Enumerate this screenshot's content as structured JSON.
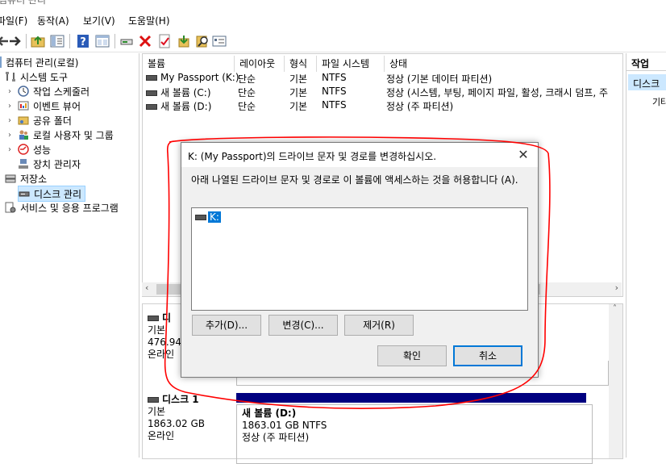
{
  "window": {
    "title": "컴퓨터 관리"
  },
  "menu": [
    "파일(F)",
    "동작(A)",
    "보기(V)",
    "도움말(H)"
  ],
  "toolbar_icons": [
    "back-arrow-icon",
    "forward-arrow-icon",
    "up-folder-icon",
    "console-tree-icon",
    "help-icon",
    "view-icon",
    "connect-drive-icon",
    "delete-icon",
    "properties-icon",
    "import-icon",
    "search-icon",
    "settings-icon"
  ],
  "tree": {
    "root": "컴퓨터 관리(로컬)",
    "items": [
      "시스템 도구",
      "작업 스케줄러",
      "이벤트 뷰어",
      "공유 폴더",
      "로컬 사용자 및 그룹",
      "성능",
      "장치 관리자",
      "저장소",
      "디스크 관리",
      "서비스 및 응용 프로그램"
    ]
  },
  "volume_list": {
    "headers": [
      "볼륨",
      "레이아웃",
      "형식",
      "파일 시스템",
      "상태"
    ],
    "rows": [
      {
        "volume": "My Passport (K:)",
        "layout": "단순",
        "type": "기본",
        "fs": "NTFS",
        "status": "정상 (기본 데이터 파티션)"
      },
      {
        "volume": "새 볼륨 (C:)",
        "layout": "단순",
        "type": "기본",
        "fs": "NTFS",
        "status": "정상 (시스템, 부팅, 페이지 파일, 활성, 크래시 덤프, 주"
      },
      {
        "volume": "새 볼륨 (D:)",
        "layout": "단순",
        "type": "기본",
        "fs": "NTFS",
        "status": "정상 (주 파티션)"
      }
    ]
  },
  "disks": [
    {
      "name": "디",
      "type": "기본",
      "size": "476.94",
      "state": "온라인"
    },
    {
      "name": "디스크 1",
      "type": "기본",
      "size": "1863.02 GB",
      "state": "온라인",
      "partition": {
        "name": "새 볼륨  (D:)",
        "size": "1863.01 GB NTFS",
        "status": "정상 (주 파티션)"
      }
    }
  ],
  "actions": {
    "header": "작업",
    "item": "디스크",
    "sub": "기타"
  },
  "dialog": {
    "title": "K: (My Passport)의 드라이브 문자 및 경로를 변경하십시오.",
    "description": "아래 나열된 드라이브 문자 및 경로로 이 볼륨에 액세스하는 것을 허용합니다 (A).",
    "list_item": "K:",
    "buttons": {
      "add": "추가(D)...",
      "change": "변경(C)...",
      "remove": "제거(R)",
      "ok": "확인",
      "cancel": "취소"
    }
  },
  "colors": {
    "selection": "#cce8ff",
    "disk_bar": "#000080",
    "annotation": "#ff0000",
    "focus": "#0078d7"
  }
}
